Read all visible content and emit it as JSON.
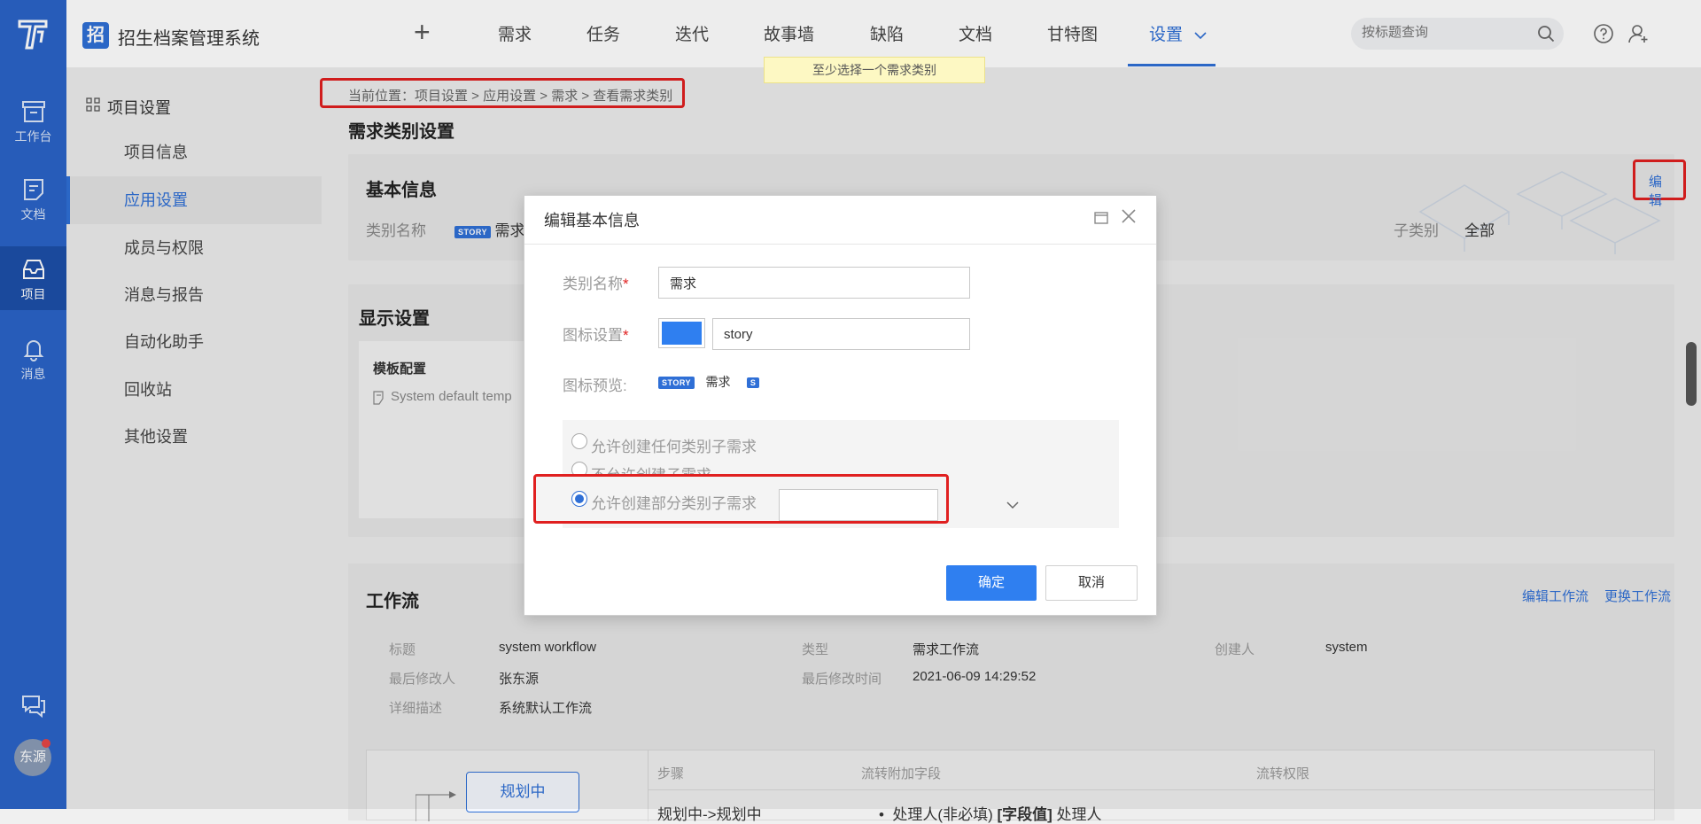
{
  "app": {
    "badge": "招",
    "title": "招生档案管理系统"
  },
  "rail": {
    "items": [
      {
        "label": "工作台",
        "icon": "archive-icon"
      },
      {
        "label": "文档",
        "icon": "doc-icon"
      },
      {
        "label": "项目",
        "icon": "inbox-icon",
        "active": true
      },
      {
        "label": "消息",
        "icon": "bell-icon"
      }
    ],
    "avatar": "东源"
  },
  "topnav": {
    "plus": "+",
    "items": [
      "需求",
      "任务",
      "迭代",
      "故事墙",
      "缺陷",
      "文档",
      "甘特图",
      "设置"
    ],
    "active": "设置",
    "search_placeholder": "按标题查询"
  },
  "toast": "至少选择一个需求类别",
  "sidebar": {
    "heading": "项目设置",
    "items": [
      "项目信息",
      "应用设置",
      "成员与权限",
      "消息与报告",
      "自动化助手",
      "回收站",
      "其他设置"
    ],
    "active": "应用设置"
  },
  "main": {
    "breadcrumb": "当前位置：项目设置 > 应用设置 > 需求 > 查看需求类别",
    "page_title": "需求类别设置",
    "basic": {
      "title": "基本信息",
      "edit": "编辑",
      "name_label": "类别名称",
      "name_tag": "STORY",
      "name_value": "需求",
      "sub_label": "子类别",
      "sub_value": "全部"
    },
    "display": {
      "title": "显示设置",
      "template_title": "模板配置",
      "template_value": "System default temp"
    },
    "workflow": {
      "title": "工作流",
      "edit_link": "编辑工作流",
      "replace_link": "更换工作流",
      "fields": [
        {
          "label": "标题",
          "value": "system workflow"
        },
        {
          "label": "类型",
          "value": "需求工作流"
        },
        {
          "label": "创建人",
          "value": "system"
        },
        {
          "label": "最后修改人",
          "value": "张东源"
        },
        {
          "label": "最后修改时间",
          "value": "2021-06-09 14:29:52"
        },
        {
          "label": "详细描述",
          "value": "系统默认工作流"
        }
      ],
      "node": "规划中",
      "table_headers": [
        "步骤",
        "流转附加字段",
        "流转权限"
      ],
      "row_step": "规划中->规划中",
      "row_field": "处理人(非必填)",
      "row_field_bold": "[字段值]",
      "row_field_tail": "处理人"
    }
  },
  "dialog": {
    "title": "编辑基本信息",
    "name_label": "类别名称",
    "name_value": "需求",
    "icon_label": "图标设置",
    "icon_value": "story",
    "icon_color": "#2f7ff0",
    "preview_label": "图标预览:",
    "preview_tag": "STORY",
    "preview_name": "需求",
    "preview_small": "S",
    "options": [
      "允许创建任何类别子需求",
      "不允许创建子需求",
      "允许创建部分类别子需求"
    ],
    "selected_option": 2,
    "ok": "确定",
    "cancel": "取消"
  }
}
